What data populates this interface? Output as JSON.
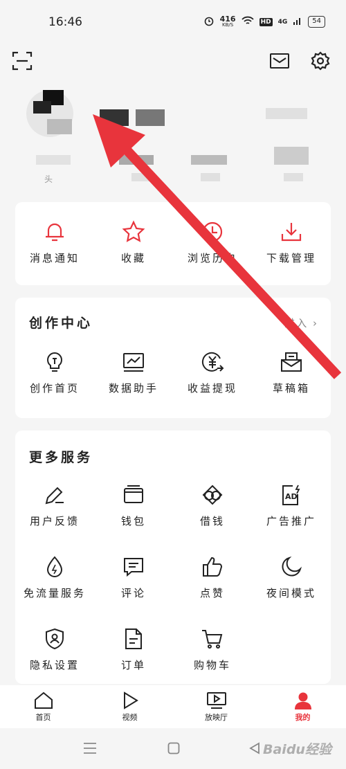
{
  "status": {
    "time": "16:46",
    "net_speed": "416",
    "net_unit": "KB/S",
    "hd": "HD",
    "signal": "4G",
    "battery": "54"
  },
  "profile": {
    "sub_label": "头"
  },
  "quick": [
    {
      "label": "消息通知",
      "icon": "bell-icon"
    },
    {
      "label": "收藏",
      "icon": "star-icon"
    },
    {
      "label": "浏览历史",
      "icon": "clock-icon"
    },
    {
      "label": "下载管理",
      "icon": "download-icon"
    }
  ],
  "creator": {
    "title": "创作中心",
    "enter": "进入",
    "items": [
      {
        "label": "创作首页",
        "icon": "bulb-icon"
      },
      {
        "label": "数据助手",
        "icon": "chart-icon"
      },
      {
        "label": "收益提现",
        "icon": "yuan-icon"
      },
      {
        "label": "草稿箱",
        "icon": "draft-icon"
      }
    ]
  },
  "more": {
    "title": "更多服务",
    "items": [
      {
        "label": "用户反馈",
        "icon": "pen-icon"
      },
      {
        "label": "钱包",
        "icon": "wallet-icon"
      },
      {
        "label": "借钱",
        "icon": "loan-icon"
      },
      {
        "label": "广告推广",
        "icon": "ad-icon"
      },
      {
        "label": "免流量服务",
        "icon": "drop-icon"
      },
      {
        "label": "评论",
        "icon": "comment-icon"
      },
      {
        "label": "点赞",
        "icon": "thumb-icon"
      },
      {
        "label": "夜间模式",
        "icon": "moon-icon"
      },
      {
        "label": "隐私设置",
        "icon": "shield-icon"
      },
      {
        "label": "订单",
        "icon": "order-icon"
      },
      {
        "label": "购物车",
        "icon": "cart-icon"
      }
    ]
  },
  "tabs": [
    {
      "label": "首页"
    },
    {
      "label": "视频"
    },
    {
      "label": "放映厅"
    },
    {
      "label": "我的"
    }
  ],
  "watermark": "Baidu经验",
  "colors": {
    "accent": "#e8343c",
    "arrow": "#e8343c"
  }
}
